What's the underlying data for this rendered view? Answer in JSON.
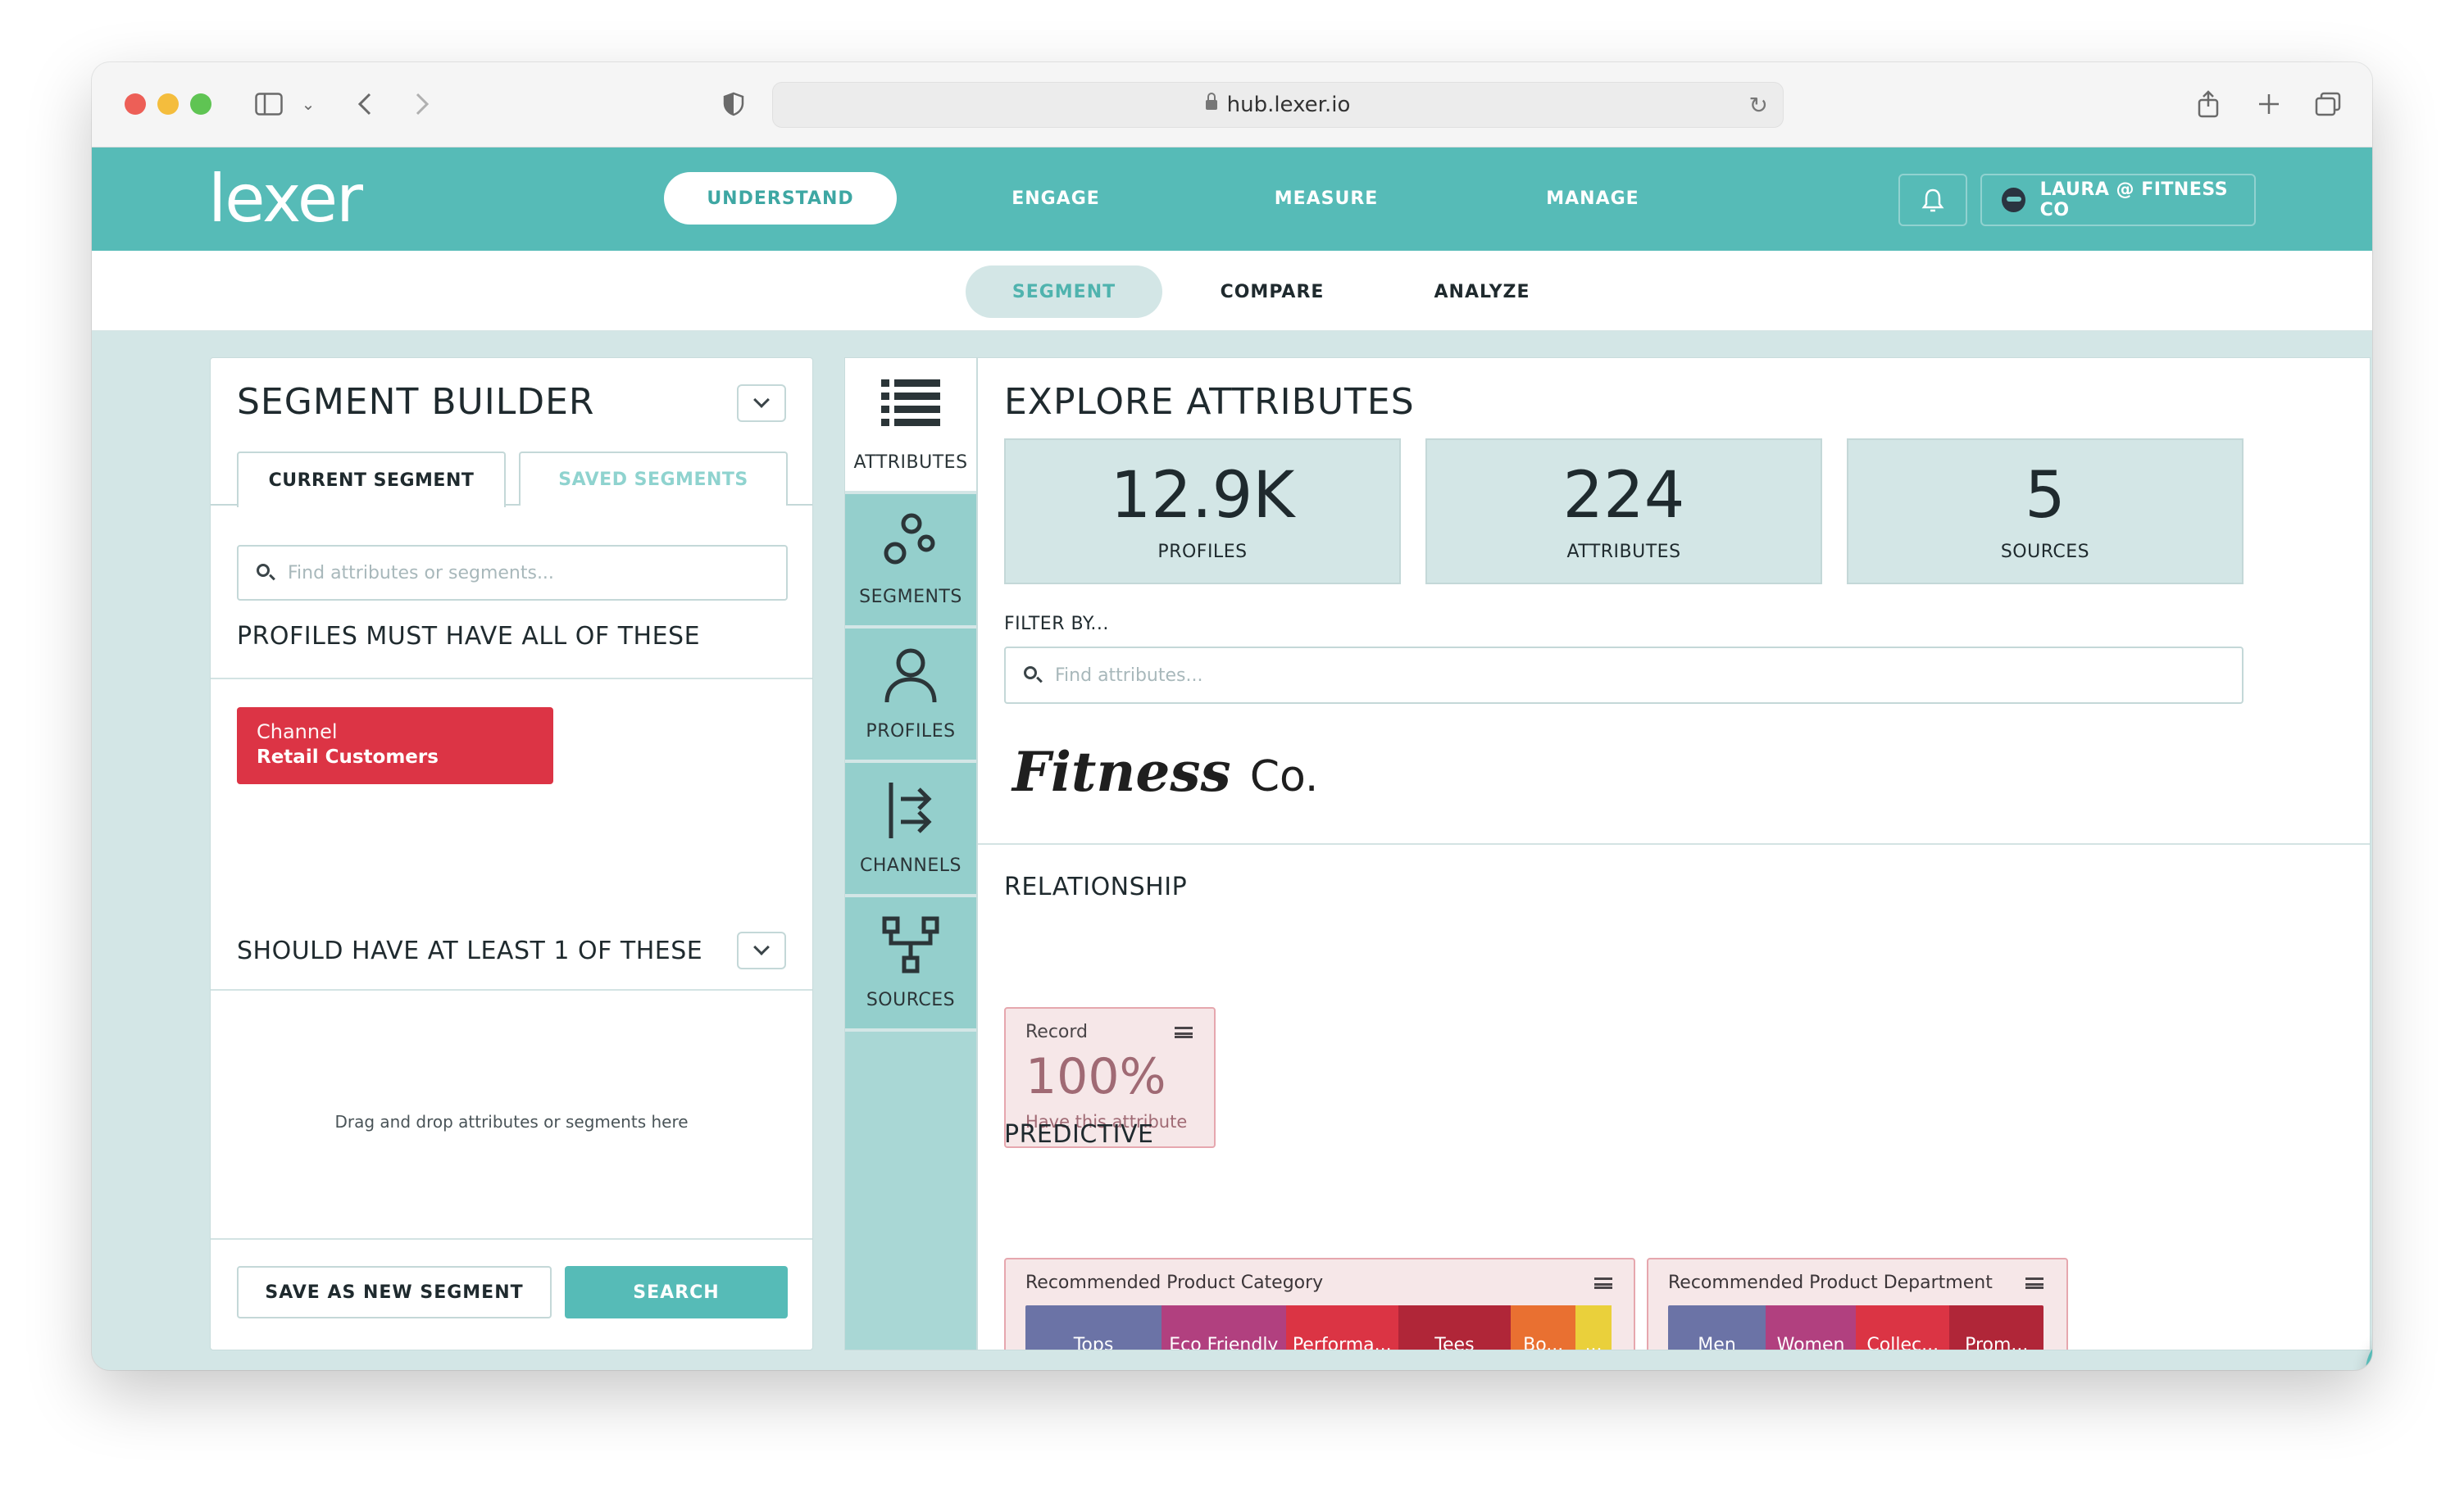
{
  "browser": {
    "url": "hub.lexer.io"
  },
  "topnav": {
    "logo": "lexer",
    "items": [
      {
        "label": "UNDERSTAND",
        "active": true
      },
      {
        "label": "ENGAGE",
        "active": false
      },
      {
        "label": "MEASURE",
        "active": false
      },
      {
        "label": "MANAGE",
        "active": false
      }
    ],
    "user_label": "LAURA @ FITNESS CO"
  },
  "subnav": {
    "items": [
      {
        "label": "SEGMENT",
        "active": true
      },
      {
        "label": "COMPARE",
        "active": false
      },
      {
        "label": "ANALYZE",
        "active": false
      }
    ]
  },
  "segment_builder": {
    "title": "SEGMENT BUILDER",
    "tabs": [
      "CURRENT SEGMENT",
      "SAVED SEGMENTS"
    ],
    "search_placeholder": "Find attributes or segments...",
    "must_have_title": "PROFILES MUST HAVE ALL OF THESE",
    "chip": {
      "key": "Channel",
      "value": "Retail Customers"
    },
    "should_have_title": "SHOULD HAVE AT LEAST 1 OF THESE",
    "dropzone_text": "Drag and drop attributes or segments here",
    "save_label": "SAVE AS NEW SEGMENT",
    "search_label": "SEARCH"
  },
  "rail": {
    "items": [
      "ATTRIBUTES",
      "SEGMENTS",
      "PROFILES",
      "CHANNELS",
      "SOURCES"
    ]
  },
  "explore": {
    "title": "EXPLORE ATTRIBUTES",
    "stats": [
      {
        "value": "12.9K",
        "label": "PROFILES"
      },
      {
        "value": "224",
        "label": "ATTRIBUTES"
      },
      {
        "value": "5",
        "label": "SOURCES"
      }
    ],
    "filter_label": "FILTER BY...",
    "filter_placeholder": "Find attributes...",
    "brand_name": "Fitness",
    "brand_suffix": "Co.",
    "relationship_title": "RELATIONSHIP",
    "record_card": {
      "title": "Record",
      "value": "100%",
      "caption": "Have this attribute"
    },
    "predictive_title": "PREDICTIVE",
    "category_card": {
      "title": "Recommended Product Category",
      "segments": [
        {
          "label": "Tops",
          "color": "#6b73a6",
          "share": 0.23
        },
        {
          "label": "Eco Friendly",
          "color": "#b1407f",
          "share": 0.21
        },
        {
          "label": "Performa...",
          "color": "#db3444",
          "share": 0.19
        },
        {
          "label": "Tees",
          "color": "#b02638",
          "share": 0.19
        },
        {
          "label": "Bo...",
          "color": "#e97031",
          "share": 0.11
        },
        {
          "label": "...",
          "color": "#ead03b",
          "share": 0.06
        }
      ]
    },
    "department_card": {
      "title": "Recommended Product Department",
      "segments": [
        {
          "label": "Men",
          "color": "#6b73a6",
          "share": 0.26
        },
        {
          "label": "Women",
          "color": "#b1407f",
          "share": 0.24
        },
        {
          "label": "Collec...",
          "color": "#db3444",
          "share": 0.25
        },
        {
          "label": "Prom...",
          "color": "#b02638",
          "share": 0.25
        }
      ]
    }
  }
}
